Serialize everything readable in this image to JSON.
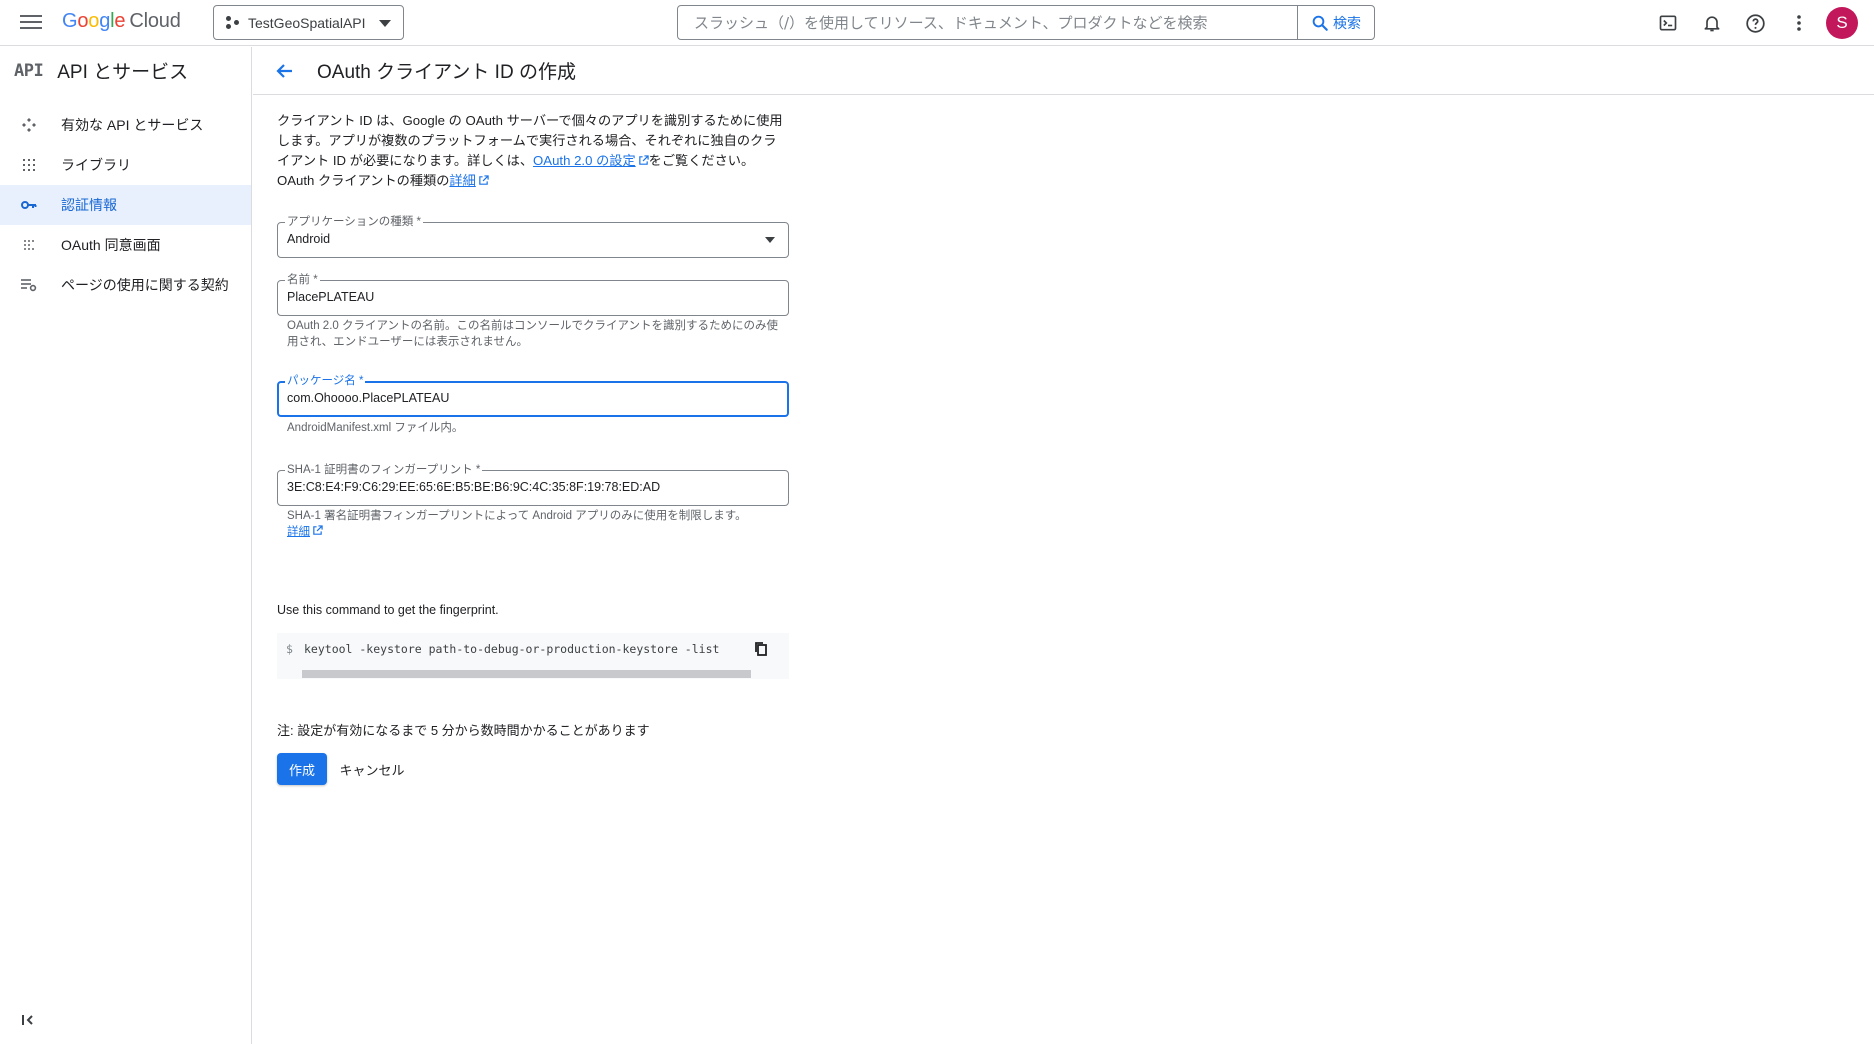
{
  "topbar": {
    "logo_google": [
      "G",
      "o",
      "o",
      "g",
      "l",
      "e"
    ],
    "logo_cloud": "Cloud",
    "project_name": "TestGeoSpatialAPI",
    "search_placeholder": "スラッシュ（/）を使用してリソース、ドキュメント、プロダクトなどを検索",
    "search_button": "検索",
    "avatar_letter": "S",
    "icons": [
      "menu-icon",
      "project-icon",
      "search-icon",
      "terminal-icon",
      "bell-icon",
      "help-icon",
      "more-vert-icon"
    ]
  },
  "sidebar": {
    "badge": "API",
    "title": "API とサービス",
    "items": [
      {
        "label": "有効な API とサービス",
        "icon": "enabled-apis-icon",
        "active": false
      },
      {
        "label": "ライブラリ",
        "icon": "library-icon",
        "active": false
      },
      {
        "label": "認証情報",
        "icon": "key-icon",
        "active": true
      },
      {
        "label": "OAuth 同意画面",
        "icon": "consent-screen-icon",
        "active": false
      },
      {
        "label": "ページの使用に関する契約",
        "icon": "agreements-icon",
        "active": false
      }
    ],
    "collapse_icon": "collapse-sidebar-icon"
  },
  "page": {
    "title": "OAuth クライアント ID の作成",
    "intro": {
      "part1": "クライアント ID は、Google の OAuth サーバーで個々のアプリを識別するために使用します。アプリが複数のプラットフォームで実行される場合、それぞれに独自のクライアント ID が必要になります。詳しくは、",
      "link1": "OAuth 2.0 の設定",
      "part2": "をご覧ください。 OAuth クライアントの種類の",
      "link2": "詳細"
    },
    "app_type": {
      "label": "アプリケーションの種類 *",
      "value": "Android"
    },
    "name": {
      "label": "名前 *",
      "value": "PlacePLATEAU",
      "hint": "OAuth 2.0 クライアントの名前。この名前はコンソールでクライアントを識別するためにのみ使用され、エンドユーザーには表示されません。"
    },
    "package": {
      "label": "パッケージ名 *",
      "value": "com.Ohoooo.PlacePLATEAU",
      "hint": "AndroidManifest.xml ファイル内。"
    },
    "sha1": {
      "label": "SHA-1 証明書のフィンガープリント *",
      "value": "3E:C8:E4:F9:C6:29:EE:65:6E:B5:BE:B6:9C:4C:35:8F:19:78:ED:AD",
      "hint": "SHA-1 署名証明書フィンガープリントによって Android アプリのみに使用を制限します。",
      "hint_link": "詳細"
    },
    "command_label": "Use this command to get the fingerprint.",
    "command_prompt": "$",
    "command": "keytool -keystore path-to-debug-or-production-keystore -list",
    "note": "注: 設定が有効になるまで 5 分から数時間かかることがあります",
    "create_button": "作成",
    "cancel_button": "キャンセル"
  },
  "colors": {
    "primary": "#1a73e8",
    "active_bg": "#e8f0fe",
    "avatar": "#c2185b"
  }
}
